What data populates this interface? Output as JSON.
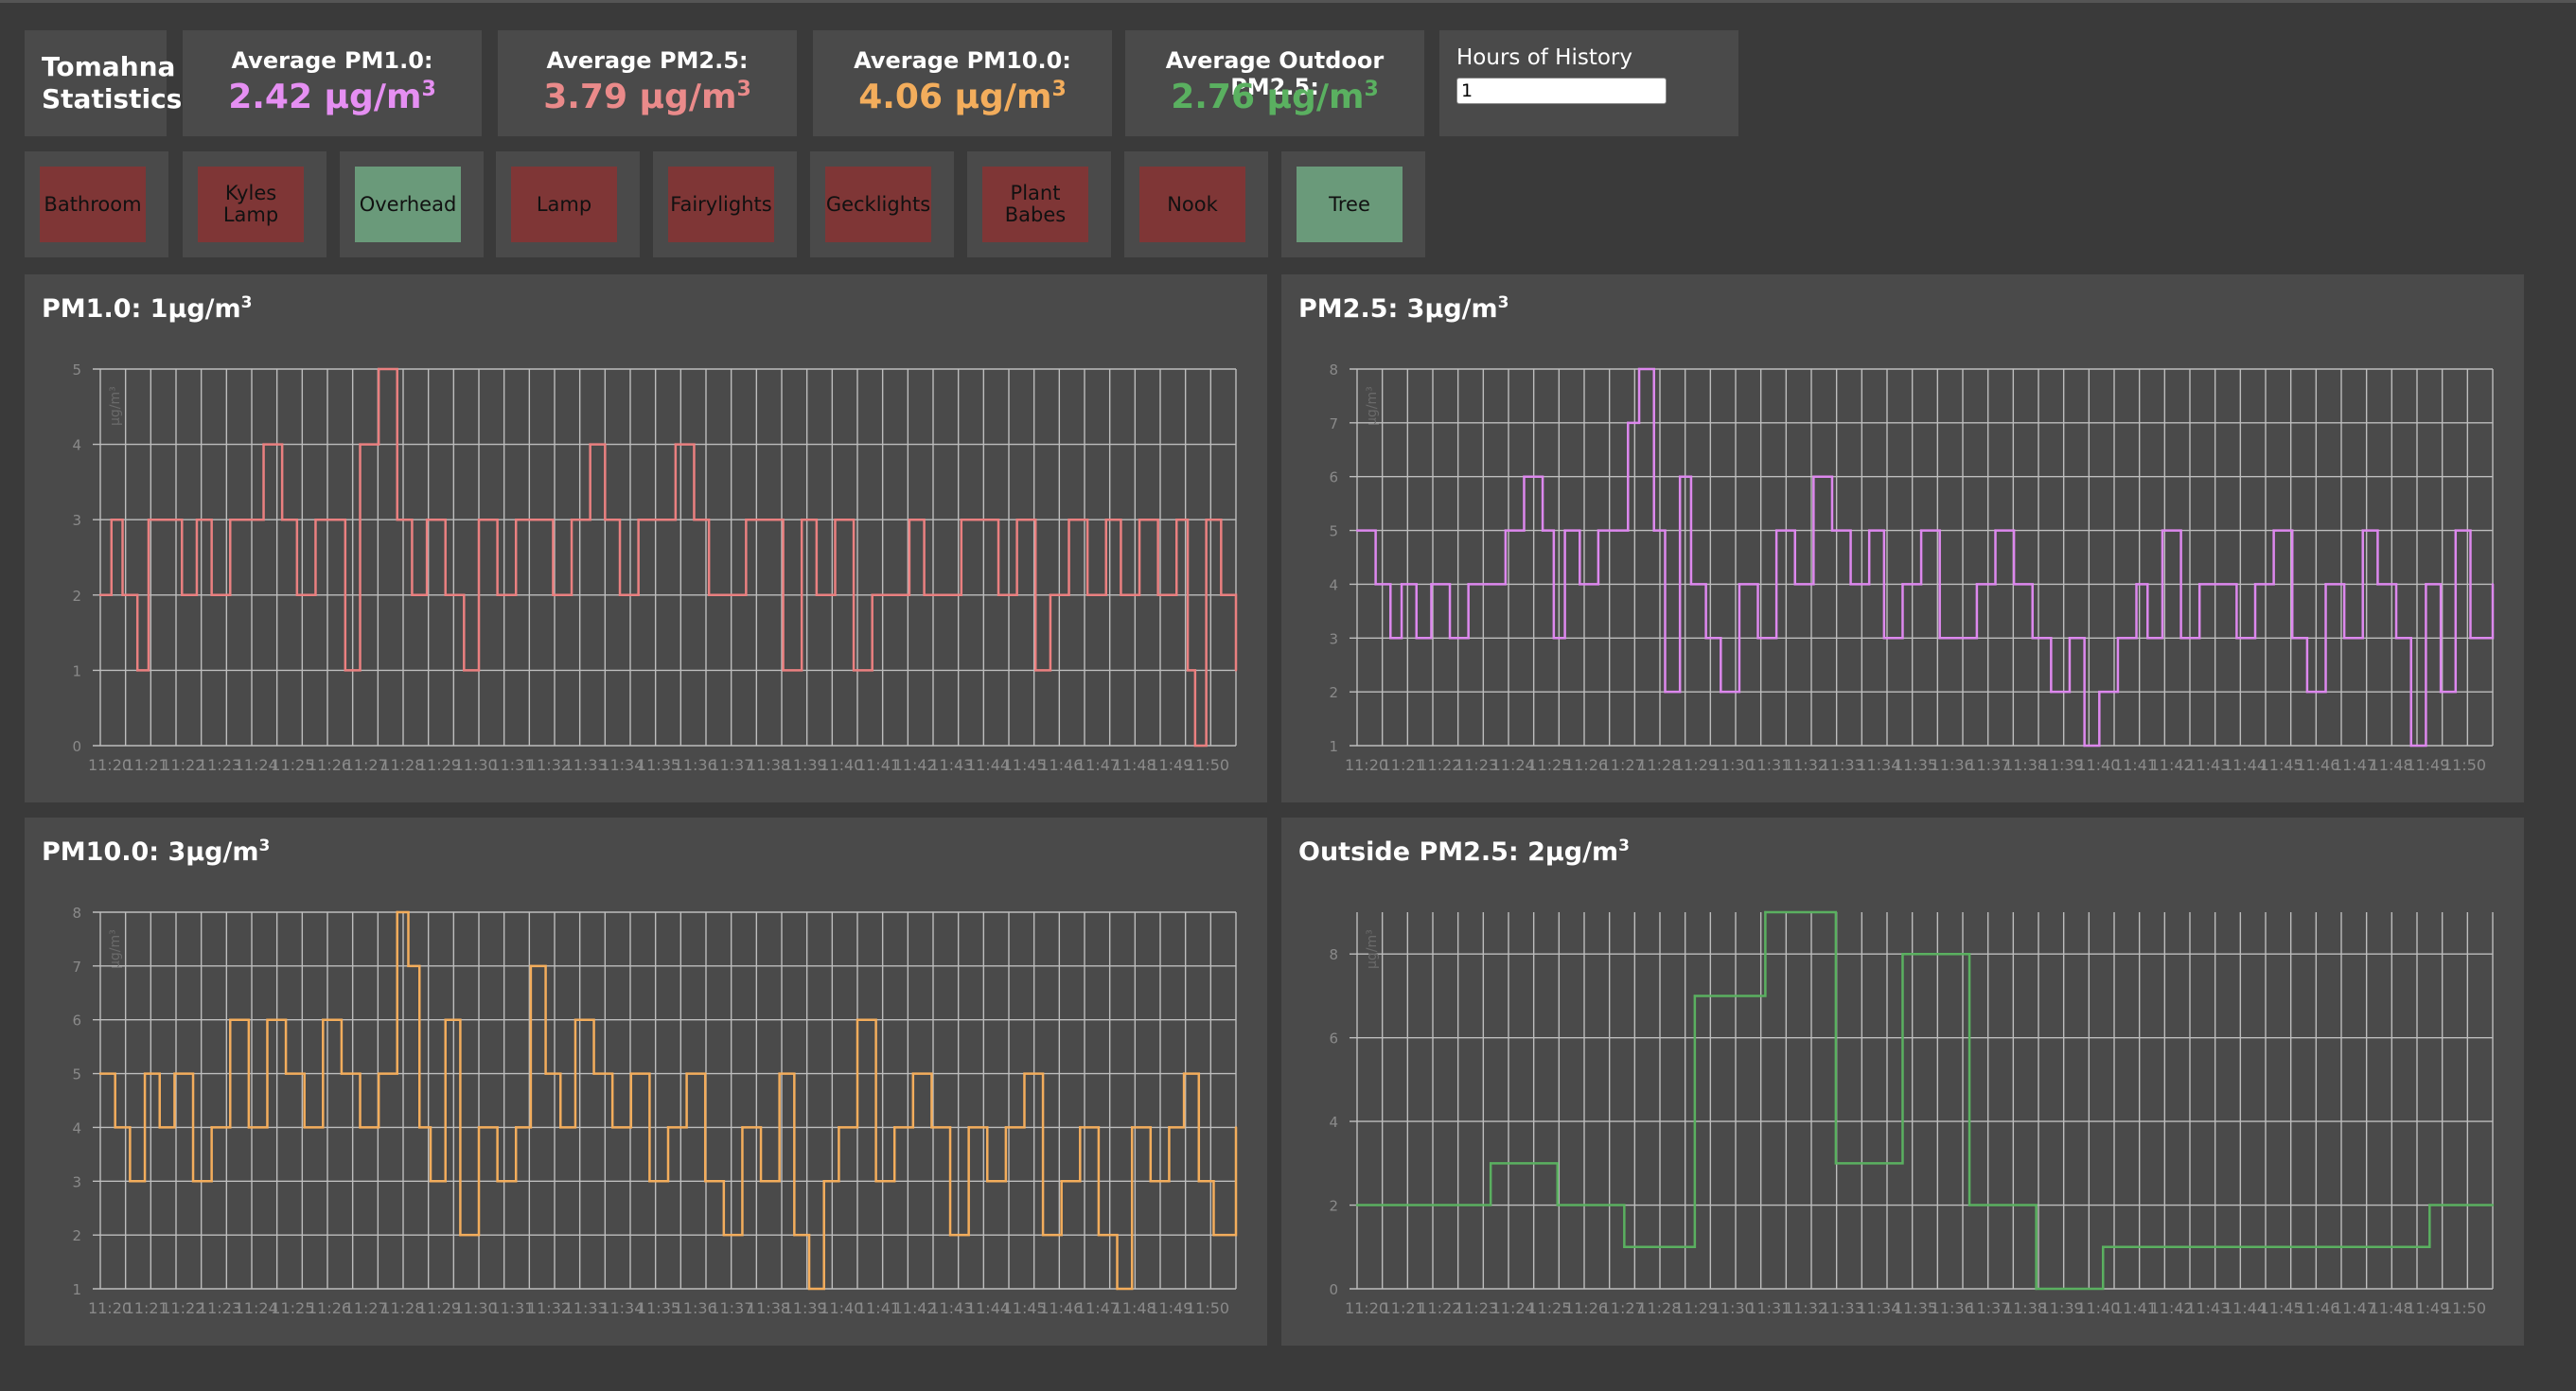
{
  "site": {
    "title": "Tomahna Statistics"
  },
  "stats": [
    {
      "title": "Average PM1.0:",
      "value": "2.42 µg/m",
      "exp": "3",
      "color": "#e58ff2"
    },
    {
      "title": "Average PM2.5:",
      "value": "3.79 µg/m",
      "exp": "3",
      "color": "#ea8a8a"
    },
    {
      "title": "Average PM10.0:",
      "value": "4.06 µg/m",
      "exp": "3",
      "color": "#f3ad5c"
    },
    {
      "title": "Average Outdoor PM2.5:",
      "value": "2.76 µg/m",
      "exp": "3",
      "color": "#5ab060"
    }
  ],
  "history": {
    "label": "Hours of History",
    "value": "1"
  },
  "lights": [
    {
      "label": "Bathroom",
      "state": "off"
    },
    {
      "label": "Kyles Lamp",
      "state": "off"
    },
    {
      "label": "Overhead",
      "state": "on"
    },
    {
      "label": "Lamp",
      "state": "off"
    },
    {
      "label": "Fairylights",
      "state": "off"
    },
    {
      "label": "Gecklights",
      "state": "off"
    },
    {
      "label": "Plant Babes",
      "state": "off"
    },
    {
      "label": "Nook",
      "state": "off"
    },
    {
      "label": "Tree",
      "state": "on"
    }
  ],
  "colors": {
    "light_on": "#6a9a7a",
    "light_off": "#7f3636"
  },
  "panels": [
    {
      "title": "PM1.0: 1µg/m",
      "exp": "3"
    },
    {
      "title": "PM2.5: 3µg/m",
      "exp": "3"
    },
    {
      "title": "PM10.0: 3µg/m",
      "exp": "3"
    },
    {
      "title": "Outside PM2.5: 2µg/m",
      "exp": "3"
    }
  ],
  "x_tick_labels": [
    "11:20",
    "11:21",
    "11:22",
    "11:23",
    "11:24",
    "11:25",
    "11:26",
    "11:27",
    "11:28",
    "11:29",
    "11:30",
    "11:31",
    "11:32",
    "11:33",
    "11:34",
    "11:35",
    "11:36",
    "11:37",
    "11:38",
    "11:39",
    "11:40",
    "11:41",
    "11:42",
    "11:43",
    "11:44",
    "11:45",
    "11:46",
    "11:47",
    "11:48",
    "11:49",
    "11:50"
  ],
  "chart_data": [
    {
      "type": "line",
      "name": "pm1",
      "color": "#ea8080",
      "ylabel": "µg/m³",
      "ylim": [
        0,
        5
      ],
      "yticks": [
        0,
        1,
        2,
        3,
        4,
        5
      ],
      "xlim": [
        0,
        30.6
      ],
      "grid": true,
      "x": [
        0,
        0.3,
        0.6,
        1.0,
        1.3,
        1.7,
        2.2,
        2.6,
        3.0,
        3.5,
        4.0,
        4.4,
        4.9,
        5.3,
        5.8,
        6.2,
        6.6,
        7.0,
        7.5,
        8.0,
        8.4,
        8.8,
        9.3,
        9.8,
        10.2,
        10.7,
        11.2,
        11.7,
        12.2,
        12.7,
        13.2,
        13.6,
        14.0,
        14.5,
        15.0,
        15.5,
        16.0,
        16.4,
        16.9,
        17.4,
        17.9,
        18.4,
        18.9,
        19.3,
        19.8,
        20.3,
        20.8,
        21.3,
        21.8,
        22.2,
        22.7,
        23.2,
        23.7,
        24.2,
        24.7,
        25.2,
        25.6,
        26.1,
        26.6,
        27.1,
        27.5,
        28.0,
        28.5,
        29.0,
        29.3,
        29.5,
        29.8,
        30.2,
        30.6
      ],
      "values": [
        2,
        3,
        2,
        1,
        3,
        3,
        2,
        3,
        2,
        3,
        3,
        4,
        3,
        2,
        3,
        3,
        1,
        4,
        5,
        3,
        2,
        3,
        2,
        1,
        3,
        2,
        3,
        3,
        2,
        3,
        4,
        3,
        2,
        3,
        3,
        4,
        3,
        2,
        2,
        3,
        3,
        1,
        3,
        2,
        3,
        1,
        2,
        2,
        3,
        2,
        2,
        3,
        3,
        2,
        3,
        1,
        2,
        3,
        2,
        3,
        2,
        3,
        2,
        3,
        1,
        0,
        3,
        2,
        1
      ],
      "time_range": "11:20–11:50"
    },
    {
      "type": "line",
      "name": "pm25",
      "color": "#dd88ee",
      "ylabel": "µg/m³",
      "ylim": [
        1,
        8
      ],
      "yticks": [
        1,
        2,
        3,
        4,
        5,
        6,
        7,
        8
      ],
      "xlim": [
        0,
        30.6
      ],
      "grid": true,
      "x": [
        0,
        0.5,
        0.9,
        1.2,
        1.6,
        2.0,
        2.5,
        3.0,
        3.5,
        4.0,
        4.5,
        5.0,
        5.3,
        5.6,
        6.0,
        6.5,
        7.0,
        7.3,
        7.6,
        8.0,
        8.3,
        8.7,
        9.0,
        9.4,
        9.8,
        10.3,
        10.8,
        11.3,
        11.8,
        12.3,
        12.8,
        13.3,
        13.8,
        14.2,
        14.7,
        15.2,
        15.7,
        16.2,
        16.7,
        17.2,
        17.7,
        18.2,
        18.7,
        19.2,
        19.6,
        20.0,
        20.5,
        21.0,
        21.3,
        21.7,
        22.2,
        22.7,
        23.2,
        23.7,
        24.2,
        24.7,
        25.2,
        25.6,
        26.1,
        26.6,
        27.1,
        27.5,
        28.0,
        28.4,
        28.8,
        29.2,
        29.6,
        30.0,
        30.6
      ],
      "values": [
        5,
        4,
        3,
        4,
        3,
        4,
        3,
        4,
        4,
        5,
        6,
        5,
        3,
        5,
        4,
        5,
        5,
        7,
        8,
        5,
        2,
        6,
        4,
        3,
        2,
        4,
        3,
        5,
        4,
        6,
        5,
        4,
        5,
        3,
        4,
        5,
        3,
        3,
        4,
        5,
        4,
        3,
        2,
        3,
        1,
        2,
        3,
        4,
        3,
        5,
        3,
        4,
        4,
        3,
        4,
        5,
        3,
        2,
        4,
        3,
        5,
        4,
        3,
        1,
        4,
        2,
        5,
        3,
        4
      ],
      "time_range": "11:20–11:50"
    },
    {
      "type": "line",
      "name": "pm10",
      "color": "#f3ad5c",
      "ylabel": "µg/m³",
      "ylim": [
        1,
        8
      ],
      "yticks": [
        1,
        2,
        3,
        4,
        5,
        6,
        7,
        8
      ],
      "xlim": [
        0,
        30.6
      ],
      "grid": true,
      "x": [
        0,
        0.4,
        0.8,
        1.2,
        1.6,
        2.0,
        2.5,
        3.0,
        3.5,
        4.0,
        4.5,
        5.0,
        5.5,
        6.0,
        6.5,
        7.0,
        7.5,
        8.0,
        8.3,
        8.6,
        8.9,
        9.3,
        9.7,
        10.2,
        10.7,
        11.2,
        11.6,
        12.0,
        12.4,
        12.8,
        13.3,
        13.8,
        14.3,
        14.8,
        15.3,
        15.8,
        16.3,
        16.8,
        17.3,
        17.8,
        18.3,
        18.7,
        19.1,
        19.5,
        19.9,
        20.4,
        20.9,
        21.4,
        21.9,
        22.4,
        22.9,
        23.4,
        23.9,
        24.4,
        24.9,
        25.4,
        25.9,
        26.4,
        26.9,
        27.4,
        27.8,
        28.3,
        28.8,
        29.2,
        29.6,
        30.0,
        30.6
      ],
      "values": [
        5,
        4,
        3,
        5,
        4,
        5,
        3,
        4,
        6,
        4,
        6,
        5,
        4,
        6,
        5,
        4,
        5,
        8,
        7,
        4,
        3,
        6,
        2,
        4,
        3,
        4,
        7,
        5,
        4,
        6,
        5,
        4,
        5,
        3,
        4,
        5,
        3,
        2,
        4,
        3,
        5,
        2,
        1,
        3,
        4,
        6,
        3,
        4,
        5,
        4,
        2,
        4,
        3,
        4,
        5,
        2,
        3,
        4,
        2,
        1,
        4,
        3,
        4,
        5,
        3,
        2,
        4
      ],
      "time_range": "11:20–11:50"
    },
    {
      "type": "line",
      "name": "outside_pm25",
      "color": "#5ab060",
      "ylabel": "µg/m³",
      "ylim": [
        0,
        9
      ],
      "yticks": [
        0,
        2,
        4,
        6,
        8
      ],
      "xlim": [
        0,
        30.6
      ],
      "grid": true,
      "x": [
        0,
        3.6,
        5.4,
        7.2,
        9.1,
        11.0,
        12.9,
        14.7,
        16.5,
        18.3,
        20.1,
        21.9,
        23.8,
        25.7,
        27.4,
        28.9,
        30.6
      ],
      "values": [
        2,
        3,
        2,
        1,
        7,
        9,
        3,
        8,
        2,
        0,
        1,
        1,
        1,
        1,
        1,
        2,
        2
      ],
      "time_range": "11:20–11:50"
    }
  ]
}
